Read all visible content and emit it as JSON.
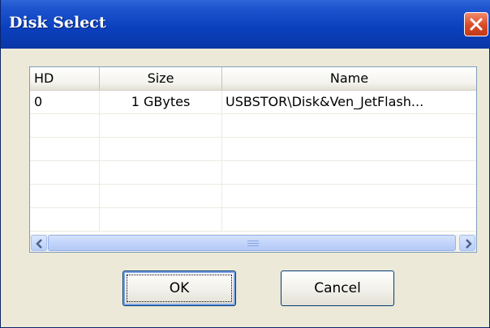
{
  "window": {
    "title": "Disk Select"
  },
  "titlebar": {
    "close_icon": "close-x-icon",
    "close_color": "#d84a27"
  },
  "table": {
    "columns": [
      "HD",
      "Size",
      "Name"
    ],
    "rows": [
      {
        "hd": "0",
        "size": "1 GBytes",
        "name": "USBSTOR\\Disk&Ven_JetFlash..."
      }
    ]
  },
  "scrollbar": {
    "left_icon": "scroll-left-arrow-icon",
    "right_icon": "scroll-right-arrow-icon"
  },
  "buttons": {
    "ok": "OK",
    "cancel": "Cancel"
  }
}
